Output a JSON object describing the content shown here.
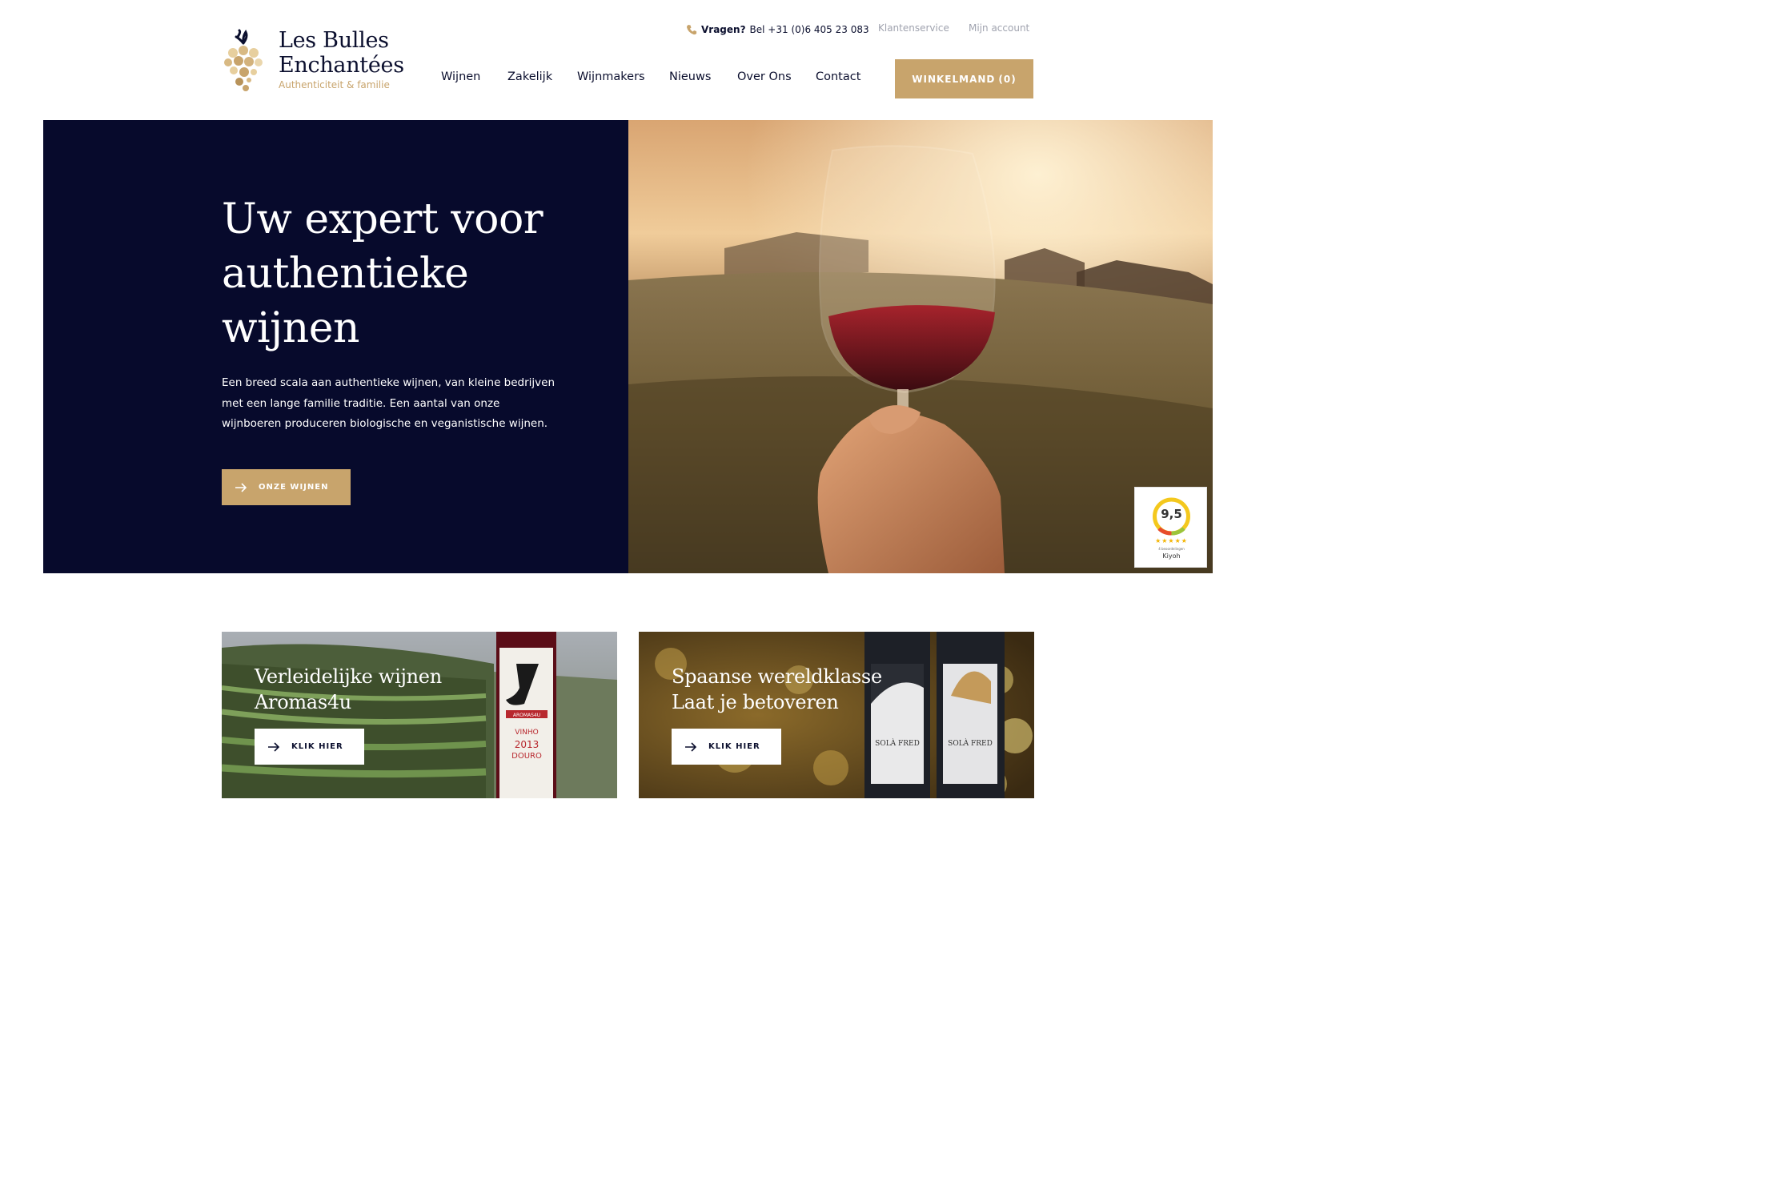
{
  "header": {
    "logo": {
      "line1": "Les Bulles",
      "line2": "Enchantées",
      "tagline": "Authenticiteit & familie"
    },
    "topbar": {
      "phone_label": "Vragen?",
      "phone_text": "Bel +31 (0)6 405 23 083",
      "klantenservice": "Klantenservice",
      "mijn_account": "Mijn account"
    },
    "nav": [
      "Wijnen",
      "Zakelijk",
      "Wijnmakers",
      "Nieuws",
      "Over Ons",
      "Contact"
    ],
    "cart": {
      "label": "WINKELMAND",
      "count": "(0)"
    }
  },
  "hero": {
    "title": "Uw expert voor authentieke wijnen",
    "text": "Een breed scala aan authentieke wijnen, van kleine bedrijven met een lange familie traditie. Een aantal van onze wijnboeren produceren biologische en veganistische wijnen.",
    "button": "ONZE WIJNEN"
  },
  "kiyoh": {
    "score": "9,5",
    "stars": "★★★★★",
    "count": "4 beoordelingen",
    "brand": "Kiyoh"
  },
  "cards": [
    {
      "title1": "Verleidelijke wijnen",
      "title2": "Aromas4u",
      "button": "KLIK HIER",
      "label_brand": "AROMAS4U",
      "label_text": "VINHO",
      "label_year": "2013",
      "label_region": "DOURO"
    },
    {
      "title1": "Spaanse wereldklasse",
      "title2": "Laat je betoveren",
      "button": "KLIK HIER",
      "bottle_label": "SOLÀ FRED"
    }
  ],
  "colors": {
    "navy": "#070a2c",
    "gold": "#c8a46c",
    "muted": "#a0a3af"
  }
}
